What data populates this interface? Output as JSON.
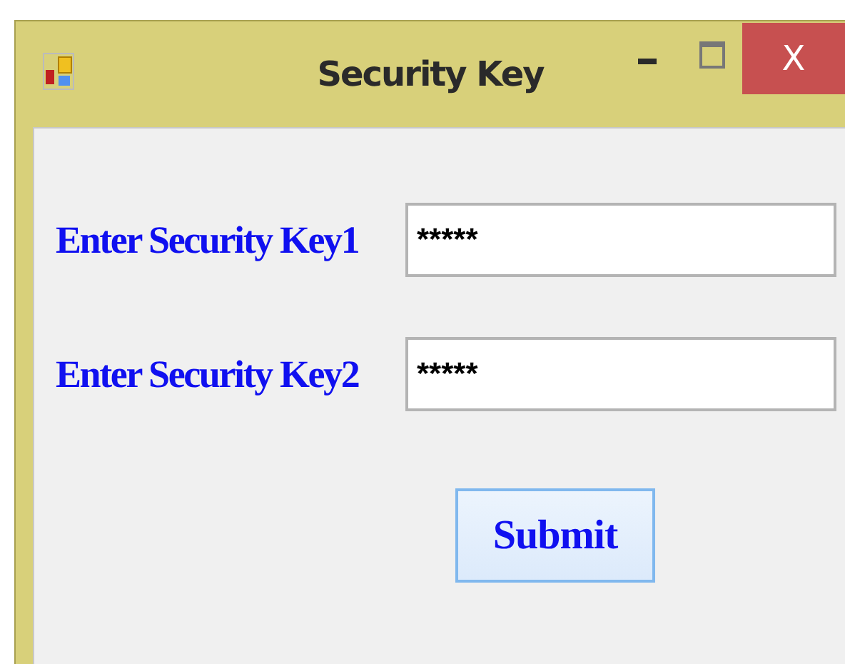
{
  "window": {
    "title": "Security Key",
    "controls": [
      {
        "kind": "minimize"
      },
      {
        "kind": "maximize"
      },
      {
        "kind": "close",
        "label": "X"
      }
    ]
  },
  "fields": [
    {
      "label": "Enter Security Key1",
      "value": "*****"
    },
    {
      "label": "Enter Security Key2",
      "value": "*****"
    }
  ],
  "buttons": [
    {
      "label": "Submit"
    }
  ]
}
